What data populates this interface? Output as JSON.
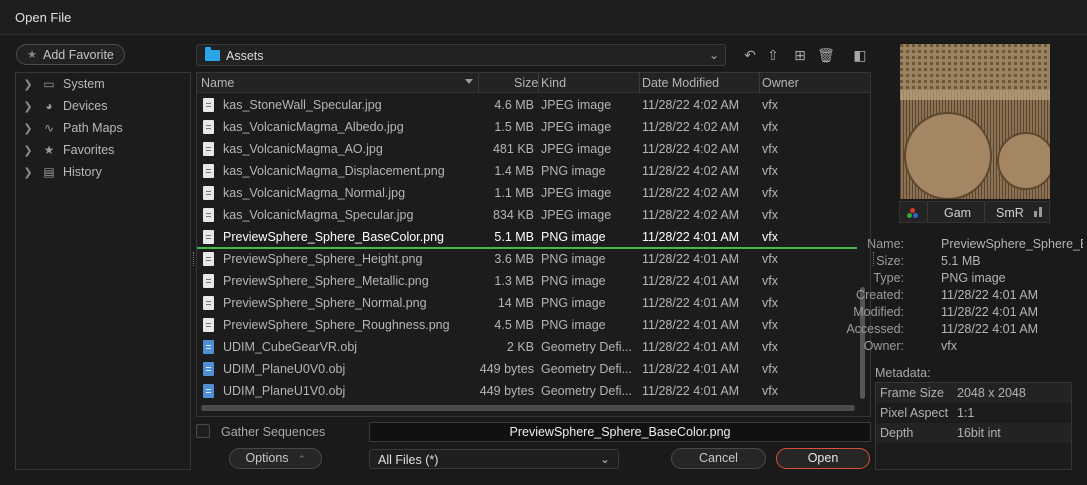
{
  "window": {
    "title": "Open File"
  },
  "sidebar": {
    "add_favorite": "Add Favorite",
    "items": [
      {
        "label": "System",
        "icon": "monitor-icon"
      },
      {
        "label": "Devices",
        "icon": "devices-icon"
      },
      {
        "label": "Path Maps",
        "icon": "path-map-icon"
      },
      {
        "label": "Favorites",
        "icon": "star-icon"
      },
      {
        "label": "History",
        "icon": "calendar-icon"
      }
    ]
  },
  "path": {
    "current": "Assets"
  },
  "toolbar": {
    "icons": [
      "undo-icon",
      "folder-up-icon",
      "new-folder-icon",
      "trash-icon",
      "toggle-preview-icon"
    ]
  },
  "table": {
    "columns": {
      "name": "Name",
      "size": "Size",
      "kind": "Kind",
      "date": "Date Modified",
      "owner": "Owner"
    },
    "rows": [
      {
        "name": "kas_StoneWall_Specular.jpg",
        "size": "4.6 MB",
        "kind": "JPEG image",
        "date": "11/28/22 4:02 AM",
        "owner": "vfx",
        "type": "image"
      },
      {
        "name": "kas_VolcanicMagma_Albedo.jpg",
        "size": "1.5 MB",
        "kind": "JPEG image",
        "date": "11/28/22 4:02 AM",
        "owner": "vfx",
        "type": "image"
      },
      {
        "name": "kas_VolcanicMagma_AO.jpg",
        "size": "481 KB",
        "kind": "JPEG image",
        "date": "11/28/22 4:02 AM",
        "owner": "vfx",
        "type": "image"
      },
      {
        "name": "kas_VolcanicMagma_Displacement.png",
        "size": "1.4 MB",
        "kind": "PNG image",
        "date": "11/28/22 4:02 AM",
        "owner": "vfx",
        "type": "image"
      },
      {
        "name": "kas_VolcanicMagma_Normal.jpg",
        "size": "1.1 MB",
        "kind": "JPEG image",
        "date": "11/28/22 4:02 AM",
        "owner": "vfx",
        "type": "image"
      },
      {
        "name": "kas_VolcanicMagma_Specular.jpg",
        "size": "834 KB",
        "kind": "JPEG image",
        "date": "11/28/22 4:02 AM",
        "owner": "vfx",
        "type": "image"
      },
      {
        "name": "PreviewSphere_Sphere_BaseColor.png",
        "size": "5.1 MB",
        "kind": "PNG image",
        "date": "11/28/22 4:01 AM",
        "owner": "vfx",
        "type": "image",
        "selected": true
      },
      {
        "name": "PreviewSphere_Sphere_Height.png",
        "size": "3.6 MB",
        "kind": "PNG image",
        "date": "11/28/22 4:01 AM",
        "owner": "vfx",
        "type": "image"
      },
      {
        "name": "PreviewSphere_Sphere_Metallic.png",
        "size": "1.3 MB",
        "kind": "PNG image",
        "date": "11/28/22 4:01 AM",
        "owner": "vfx",
        "type": "image"
      },
      {
        "name": "PreviewSphere_Sphere_Normal.png",
        "size": "14 MB",
        "kind": "PNG image",
        "date": "11/28/22 4:01 AM",
        "owner": "vfx",
        "type": "image"
      },
      {
        "name": "PreviewSphere_Sphere_Roughness.png",
        "size": "4.5 MB",
        "kind": "PNG image",
        "date": "11/28/22 4:01 AM",
        "owner": "vfx",
        "type": "image"
      },
      {
        "name": "UDIM_CubeGearVR.obj",
        "size": "2 KB",
        "kind": "Geometry Defi...",
        "date": "11/28/22 4:01 AM",
        "owner": "vfx",
        "type": "obj"
      },
      {
        "name": "UDIM_PlaneU0V0.obj",
        "size": "449 bytes",
        "kind": "Geometry Defi...",
        "date": "11/28/22 4:01 AM",
        "owner": "vfx",
        "type": "obj"
      },
      {
        "name": "UDIM_PlaneU1V0.obj",
        "size": "449 bytes",
        "kind": "Geometry Defi...",
        "date": "11/28/22 4:01 AM",
        "owner": "vfx",
        "type": "obj"
      }
    ]
  },
  "bottom": {
    "gather_sequences": "Gather Sequences",
    "filename": "PreviewSphere_Sphere_BaseColor.png",
    "options": "Options",
    "filter": "All Files (*)",
    "cancel": "Cancel",
    "open": "Open"
  },
  "preview": {
    "gam": "Gam",
    "smr": "SmR",
    "info": [
      {
        "k": "Name:",
        "v": "PreviewSphere_Sphere_B"
      },
      {
        "k": "Size:",
        "v": "5.1 MB"
      },
      {
        "k": "Type:",
        "v": "PNG image"
      },
      {
        "k": "Created:",
        "v": "11/28/22 4:01 AM"
      },
      {
        "k": "Modified:",
        "v": "11/28/22 4:01 AM"
      },
      {
        "k": "Accessed:",
        "v": "11/28/22 4:01 AM"
      },
      {
        "k": "Owner:",
        "v": "vfx"
      }
    ],
    "metadata_label": "Metadata:",
    "metadata": [
      {
        "k": "Frame Size",
        "v": "2048 x 2048"
      },
      {
        "k": "Pixel Aspect",
        "v": "1:1"
      },
      {
        "k": "Depth",
        "v": "16bit int"
      }
    ]
  },
  "colors": {
    "accent_open": "#d3513f",
    "selection_line": "#47b84f",
    "folder": "#2aa5e8"
  }
}
